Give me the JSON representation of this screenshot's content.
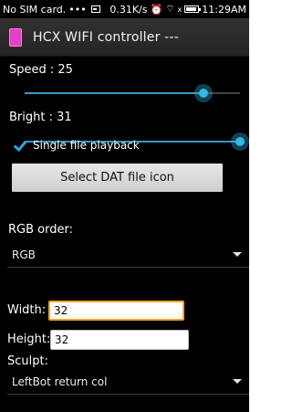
{
  "status_bar": {
    "carrier": "No SIM card.",
    "dots": "•••",
    "speed": "0.31K/s",
    "alarm_glyph": "⏰",
    "wifi_glyph": "⌔",
    "signal_glyph": "x",
    "time": "11:29AM"
  },
  "title_bar": {
    "title": "HCX WIFI controller ---",
    "icon": "app-icon"
  },
  "speed": {
    "label": "Speed : 25",
    "value": 25
  },
  "bright": {
    "label": "Bright : 31",
    "value": 31
  },
  "single_playback": {
    "label": "Single file playback",
    "checked": true
  },
  "select_dat_button": {
    "label": "Select DAT file icon"
  },
  "rgb_order": {
    "label": "RGB order:",
    "value": "RGB"
  },
  "width": {
    "label": "Width:",
    "value": "32"
  },
  "height": {
    "label": "Height:",
    "value": "32"
  },
  "sculpt": {
    "label": "Sculpt:",
    "value": "LeftBot return col"
  },
  "colors": {
    "accent": "#35b5e5",
    "background": "#000000",
    "focus": "#f5a623"
  }
}
